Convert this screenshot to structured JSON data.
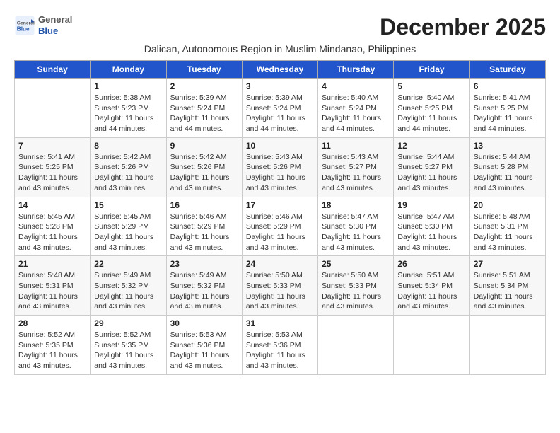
{
  "header": {
    "logo_general": "General",
    "logo_blue": "Blue",
    "month_title": "December 2025",
    "subtitle": "Dalican, Autonomous Region in Muslim Mindanao, Philippines"
  },
  "weekdays": [
    "Sunday",
    "Monday",
    "Tuesday",
    "Wednesday",
    "Thursday",
    "Friday",
    "Saturday"
  ],
  "weeks": [
    [
      {
        "day": "",
        "info": ""
      },
      {
        "day": "1",
        "info": "Sunrise: 5:38 AM\nSunset: 5:23 PM\nDaylight: 11 hours\nand 44 minutes."
      },
      {
        "day": "2",
        "info": "Sunrise: 5:39 AM\nSunset: 5:24 PM\nDaylight: 11 hours\nand 44 minutes."
      },
      {
        "day": "3",
        "info": "Sunrise: 5:39 AM\nSunset: 5:24 PM\nDaylight: 11 hours\nand 44 minutes."
      },
      {
        "day": "4",
        "info": "Sunrise: 5:40 AM\nSunset: 5:24 PM\nDaylight: 11 hours\nand 44 minutes."
      },
      {
        "day": "5",
        "info": "Sunrise: 5:40 AM\nSunset: 5:25 PM\nDaylight: 11 hours\nand 44 minutes."
      },
      {
        "day": "6",
        "info": "Sunrise: 5:41 AM\nSunset: 5:25 PM\nDaylight: 11 hours\nand 44 minutes."
      }
    ],
    [
      {
        "day": "7",
        "info": "Sunrise: 5:41 AM\nSunset: 5:25 PM\nDaylight: 11 hours\nand 43 minutes."
      },
      {
        "day": "8",
        "info": "Sunrise: 5:42 AM\nSunset: 5:26 PM\nDaylight: 11 hours\nand 43 minutes."
      },
      {
        "day": "9",
        "info": "Sunrise: 5:42 AM\nSunset: 5:26 PM\nDaylight: 11 hours\nand 43 minutes."
      },
      {
        "day": "10",
        "info": "Sunrise: 5:43 AM\nSunset: 5:26 PM\nDaylight: 11 hours\nand 43 minutes."
      },
      {
        "day": "11",
        "info": "Sunrise: 5:43 AM\nSunset: 5:27 PM\nDaylight: 11 hours\nand 43 minutes."
      },
      {
        "day": "12",
        "info": "Sunrise: 5:44 AM\nSunset: 5:27 PM\nDaylight: 11 hours\nand 43 minutes."
      },
      {
        "day": "13",
        "info": "Sunrise: 5:44 AM\nSunset: 5:28 PM\nDaylight: 11 hours\nand 43 minutes."
      }
    ],
    [
      {
        "day": "14",
        "info": "Sunrise: 5:45 AM\nSunset: 5:28 PM\nDaylight: 11 hours\nand 43 minutes."
      },
      {
        "day": "15",
        "info": "Sunrise: 5:45 AM\nSunset: 5:29 PM\nDaylight: 11 hours\nand 43 minutes."
      },
      {
        "day": "16",
        "info": "Sunrise: 5:46 AM\nSunset: 5:29 PM\nDaylight: 11 hours\nand 43 minutes."
      },
      {
        "day": "17",
        "info": "Sunrise: 5:46 AM\nSunset: 5:29 PM\nDaylight: 11 hours\nand 43 minutes."
      },
      {
        "day": "18",
        "info": "Sunrise: 5:47 AM\nSunset: 5:30 PM\nDaylight: 11 hours\nand 43 minutes."
      },
      {
        "day": "19",
        "info": "Sunrise: 5:47 AM\nSunset: 5:30 PM\nDaylight: 11 hours\nand 43 minutes."
      },
      {
        "day": "20",
        "info": "Sunrise: 5:48 AM\nSunset: 5:31 PM\nDaylight: 11 hours\nand 43 minutes."
      }
    ],
    [
      {
        "day": "21",
        "info": "Sunrise: 5:48 AM\nSunset: 5:31 PM\nDaylight: 11 hours\nand 43 minutes."
      },
      {
        "day": "22",
        "info": "Sunrise: 5:49 AM\nSunset: 5:32 PM\nDaylight: 11 hours\nand 43 minutes."
      },
      {
        "day": "23",
        "info": "Sunrise: 5:49 AM\nSunset: 5:32 PM\nDaylight: 11 hours\nand 43 minutes."
      },
      {
        "day": "24",
        "info": "Sunrise: 5:50 AM\nSunset: 5:33 PM\nDaylight: 11 hours\nand 43 minutes."
      },
      {
        "day": "25",
        "info": "Sunrise: 5:50 AM\nSunset: 5:33 PM\nDaylight: 11 hours\nand 43 minutes."
      },
      {
        "day": "26",
        "info": "Sunrise: 5:51 AM\nSunset: 5:34 PM\nDaylight: 11 hours\nand 43 minutes."
      },
      {
        "day": "27",
        "info": "Sunrise: 5:51 AM\nSunset: 5:34 PM\nDaylight: 11 hours\nand 43 minutes."
      }
    ],
    [
      {
        "day": "28",
        "info": "Sunrise: 5:52 AM\nSunset: 5:35 PM\nDaylight: 11 hours\nand 43 minutes."
      },
      {
        "day": "29",
        "info": "Sunrise: 5:52 AM\nSunset: 5:35 PM\nDaylight: 11 hours\nand 43 minutes."
      },
      {
        "day": "30",
        "info": "Sunrise: 5:53 AM\nSunset: 5:36 PM\nDaylight: 11 hours\nand 43 minutes."
      },
      {
        "day": "31",
        "info": "Sunrise: 5:53 AM\nSunset: 5:36 PM\nDaylight: 11 hours\nand 43 minutes."
      },
      {
        "day": "",
        "info": ""
      },
      {
        "day": "",
        "info": ""
      },
      {
        "day": "",
        "info": ""
      }
    ]
  ]
}
